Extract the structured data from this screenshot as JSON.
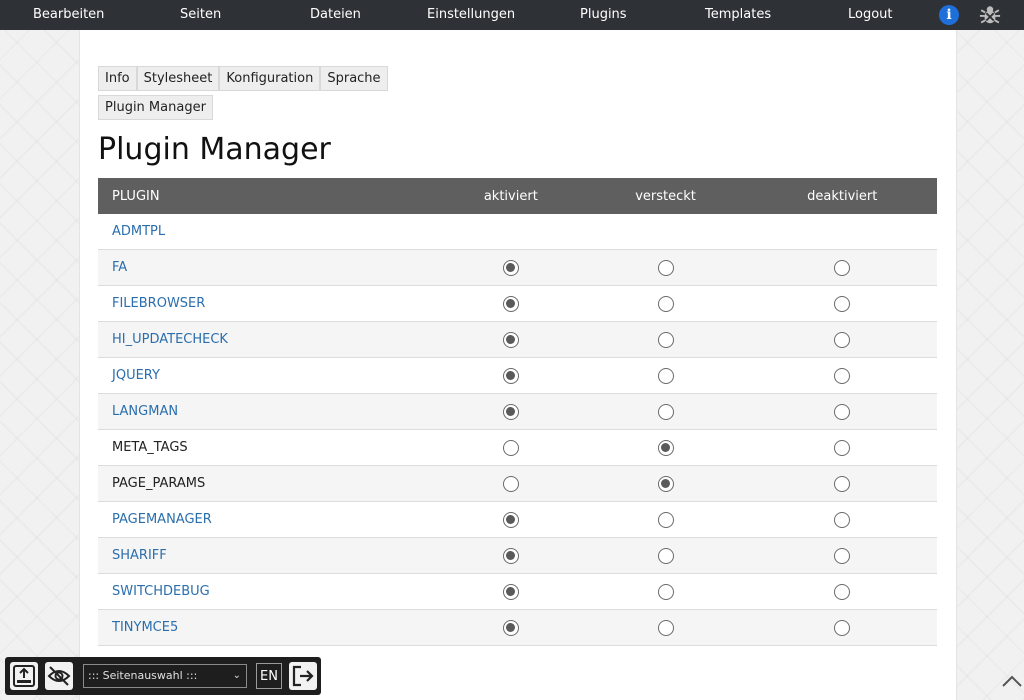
{
  "topbar": {
    "items": [
      {
        "label": "Bearbeiten"
      },
      {
        "label": "Seiten"
      },
      {
        "label": "Dateien"
      },
      {
        "label": "Einstellungen"
      },
      {
        "label": "Plugins"
      },
      {
        "label": "Templates"
      },
      {
        "label": "Logout"
      }
    ],
    "info_icon": "info-icon",
    "debug_icon": "bug-icon",
    "info_glyph": "i"
  },
  "tabs": [
    {
      "label": "Info"
    },
    {
      "label": "Stylesheet"
    },
    {
      "label": "Konfiguration"
    },
    {
      "label": "Sprache"
    },
    {
      "label": "Plugin Manager"
    }
  ],
  "page_title": "Plugin Manager",
  "table": {
    "headers": {
      "plugin": "PLUGIN",
      "active": "aktiviert",
      "hidden": "versteckt",
      "disabled": "deaktiviert"
    },
    "rows": [
      {
        "name": "ADMTPL",
        "link": true,
        "state": "none"
      },
      {
        "name": "FA",
        "link": true,
        "state": "active"
      },
      {
        "name": "FILEBROWSER",
        "link": true,
        "state": "active"
      },
      {
        "name": "HI_UPDATECHECK",
        "link": true,
        "state": "active"
      },
      {
        "name": "JQUERY",
        "link": true,
        "state": "active"
      },
      {
        "name": "LANGMAN",
        "link": true,
        "state": "active"
      },
      {
        "name": "META_TAGS",
        "link": false,
        "state": "hidden"
      },
      {
        "name": "PAGE_PARAMS",
        "link": false,
        "state": "hidden"
      },
      {
        "name": "PAGEMANAGER",
        "link": true,
        "state": "active"
      },
      {
        "name": "SHARIFF",
        "link": true,
        "state": "active"
      },
      {
        "name": "SWITCHDEBUG",
        "link": true,
        "state": "active"
      },
      {
        "name": "TINYMCE5",
        "link": true,
        "state": "active"
      }
    ]
  },
  "bottom_toolbar": {
    "page_select_value": "::: Seitenauswahl :::",
    "language": "EN",
    "icons": [
      "edit-mode-icon",
      "hide-eye-icon",
      "logout-icon"
    ]
  },
  "colors": {
    "topbar_bg": "#2e3236",
    "header_bg": "#5f5f5f",
    "link": "#2a6ead",
    "info_blue": "#1e6fd9"
  }
}
